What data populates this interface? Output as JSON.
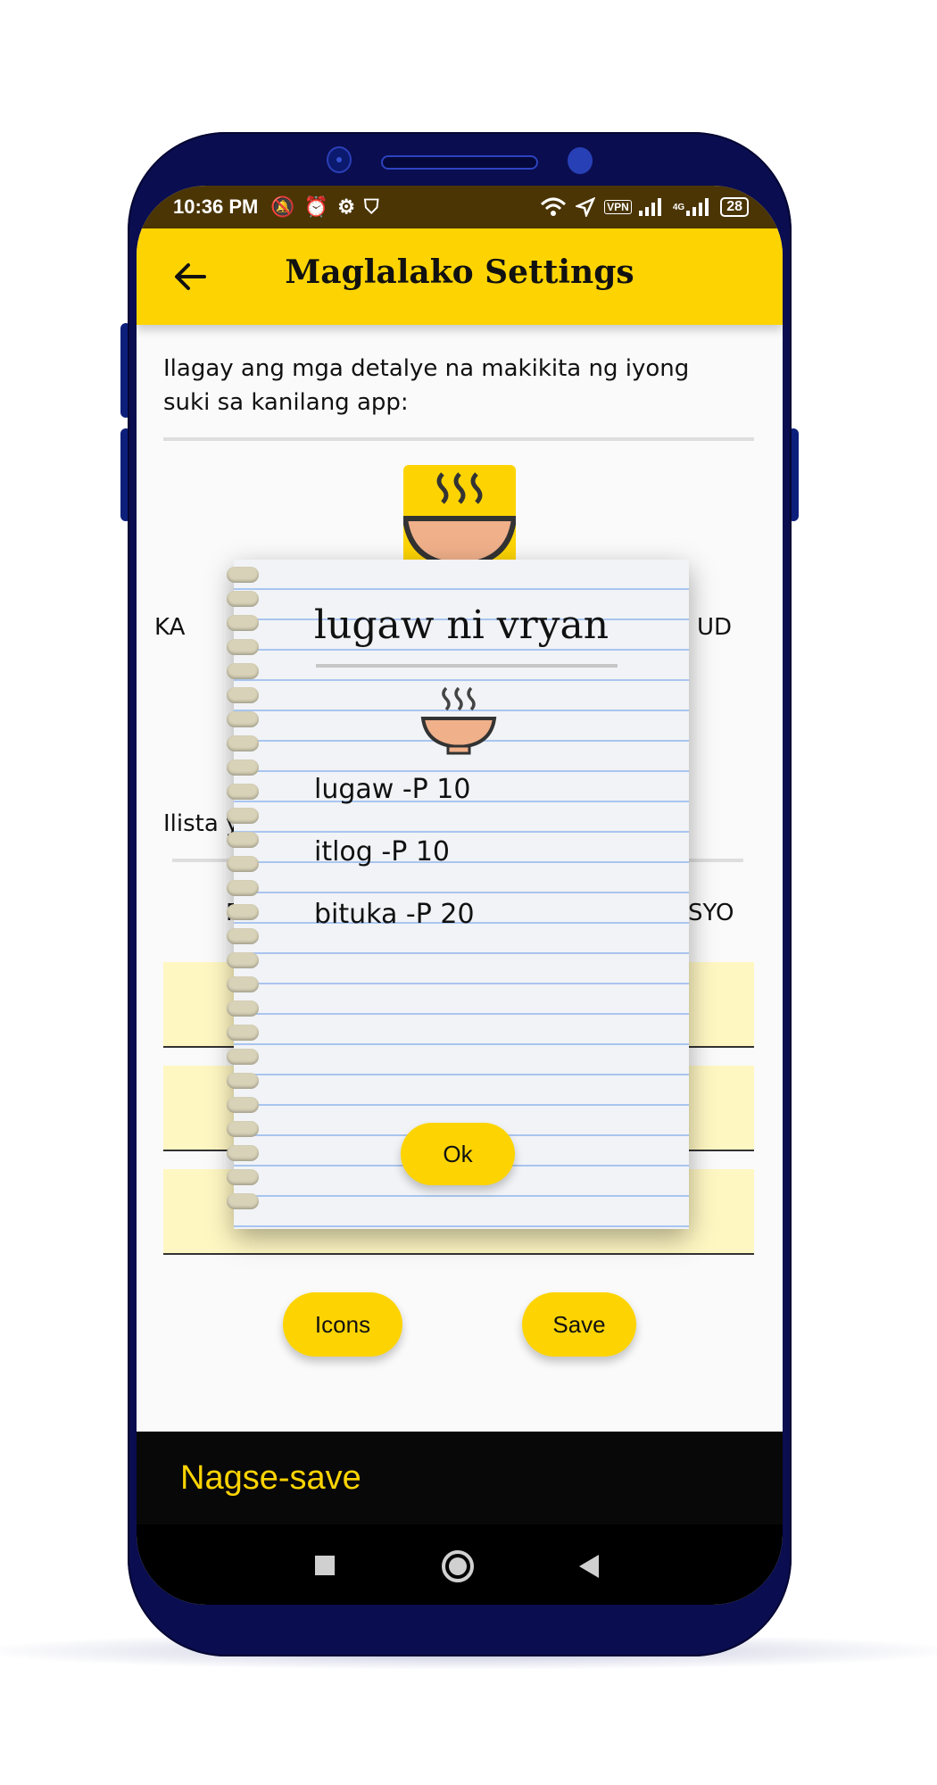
{
  "status_bar": {
    "time": "10:36 PM",
    "vpn": "VPN",
    "network": "4G",
    "battery": "28"
  },
  "app_bar": {
    "title": "Maglalako Settings"
  },
  "settings": {
    "intro_text": "Ilagay ang mga detalye na makikita ng iyong suki sa kanilang app:",
    "partial_left_1": "KA",
    "partial_right_1": "UD",
    "partial_list_label": "Ilista y",
    "partial_right_2": "SYO",
    "partial_left_2": "PR",
    "icons_button": "Icons",
    "save_button": "Save"
  },
  "snackbar": {
    "message": "Nagse-save"
  },
  "dialog": {
    "title": "lugaw ni vryan",
    "items": [
      {
        "text": "lugaw -P 10"
      },
      {
        "text": "itlog -P 10"
      },
      {
        "text": "bituka -P 20"
      }
    ],
    "ok_button": "Ok"
  },
  "colors": {
    "accent": "#fdd402",
    "status_bar": "#4b3504",
    "phone_body": "#0a0d4f",
    "snackbar_text": "#fdd402"
  }
}
